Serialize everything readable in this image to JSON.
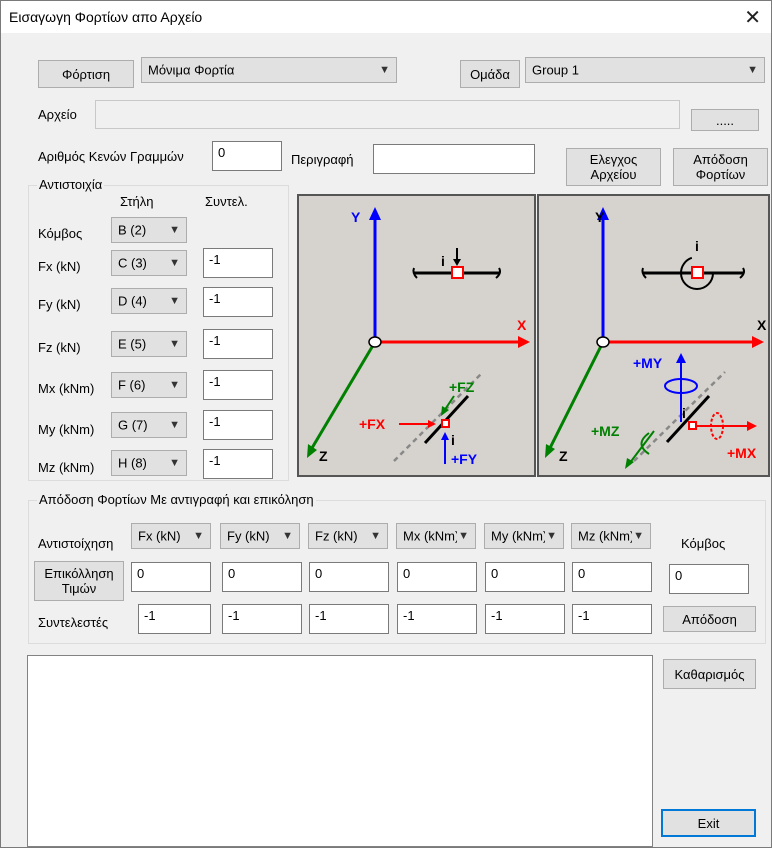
{
  "window": {
    "title": "Εισαγωγη Φορτίων απο Αρχείο",
    "close": "✕"
  },
  "top": {
    "load_label": "Φόρτιση",
    "load_value": "Μόνιμα Φορτία",
    "group_label": "Ομάδα",
    "group_value": "Group 1",
    "file_label": "Αρχείο",
    "file_value": "",
    "browse_label": ".....",
    "empty_lines_label": "Αριθμός Κενών Γραμμών",
    "empty_lines_value": "0",
    "desc_label": "Περιγραφή",
    "desc_value": "",
    "check_label": "Ελεγχος Αρχείου",
    "assign_label": "Απόδοση Φορτίων"
  },
  "mapping": {
    "group_label": "Αντιστοιχία",
    "col_header": "Στήλη",
    "factor_header": "Συντελ.",
    "rows": [
      {
        "label": "Κόμβος",
        "col": "B (2)",
        "factor": null
      },
      {
        "label": "Fx (kN)",
        "col": "C (3)",
        "factor": "-1"
      },
      {
        "label": "Fy (kN)",
        "col": "D (4)",
        "factor": "-1"
      },
      {
        "label": "Fz (kN)",
        "col": "E (5)",
        "factor": "-1"
      },
      {
        "label": "Mx (kNm)",
        "col": "F (6)",
        "factor": "-1"
      },
      {
        "label": "My (kNm)",
        "col": "G (7)",
        "factor": "-1"
      },
      {
        "label": "Mz (kNm)",
        "col": "H (8)",
        "factor": "-1"
      }
    ]
  },
  "diagram": {
    "left": {
      "y": "Y",
      "x": "X",
      "z": "Z",
      "i": "i",
      "fz": "+FZ",
      "fx": "+FX",
      "fy": "+FY"
    },
    "right": {
      "y": "Y",
      "x": "X",
      "z": "Z",
      "i": "i",
      "my": "+MY",
      "mz": "+MZ",
      "mx": "+MX"
    }
  },
  "paste": {
    "group_label": "Απόδοση Φορτίων Με αντιγραφή και επικόληση",
    "map_label": "Αντιστοίχηση",
    "combos": [
      "Fx (kN)",
      "Fy (kN)",
      "Fz (kN)",
      "Mx (kNm)",
      "My (kNm)",
      "Mz (kNm)"
    ],
    "node_label": "Κόμβος",
    "paste_button": "Επικόλληση Τιμών",
    "values": [
      "0",
      "0",
      "0",
      "0",
      "0",
      "0"
    ],
    "node_value": "0",
    "factors_label": "Συντελεστές",
    "factors": [
      "-1",
      "-1",
      "-1",
      "-1",
      "-1",
      "-1"
    ],
    "assign_button": "Απόδοση"
  },
  "bottom": {
    "clear_button": "Καθαρισμός",
    "exit_button": "Exit",
    "log_text": ""
  }
}
